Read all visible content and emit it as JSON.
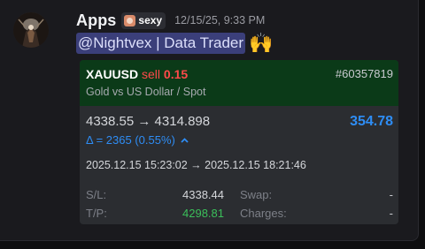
{
  "message": {
    "username": "Apps",
    "role_tag": "sexy",
    "timestamp": "12/15/25, 9:33 PM",
    "mention": "@Nightvex | Data Trader",
    "emoji": "🙌"
  },
  "trade_card": {
    "symbol": "XAUUSD",
    "direction": "sell",
    "lots": "0.15",
    "order_id": "#60357819",
    "instrument": "Gold vs US Dollar / Spot",
    "price_change": "4338.55 → 4314.898",
    "profit": "354.78",
    "delta": "Δ = 2365 (0.55%)",
    "delta_caret": "^",
    "time_range": "2025.12.15 15:23:02 → 2025.12.15 18:21:46",
    "sl_label": "S/L:",
    "sl_value": "4338.44",
    "tp_label": "T/P:",
    "tp_value": "4298.81",
    "swap_label": "Swap:",
    "swap_value": "-",
    "charges_label": "Charges:",
    "charges_value": "-"
  },
  "colors": {
    "header_bg": "#0b3a18",
    "sell": "#ff4a4a",
    "profit": "#2e8df5",
    "take_profit": "#3bbf5a",
    "mention_bg": "#3b3f7a"
  },
  "icons": {
    "avatar": "dark-figure-avatar",
    "role_tag_icon": "cat-face-icon",
    "delta_caret": "chevron-up-icon"
  }
}
